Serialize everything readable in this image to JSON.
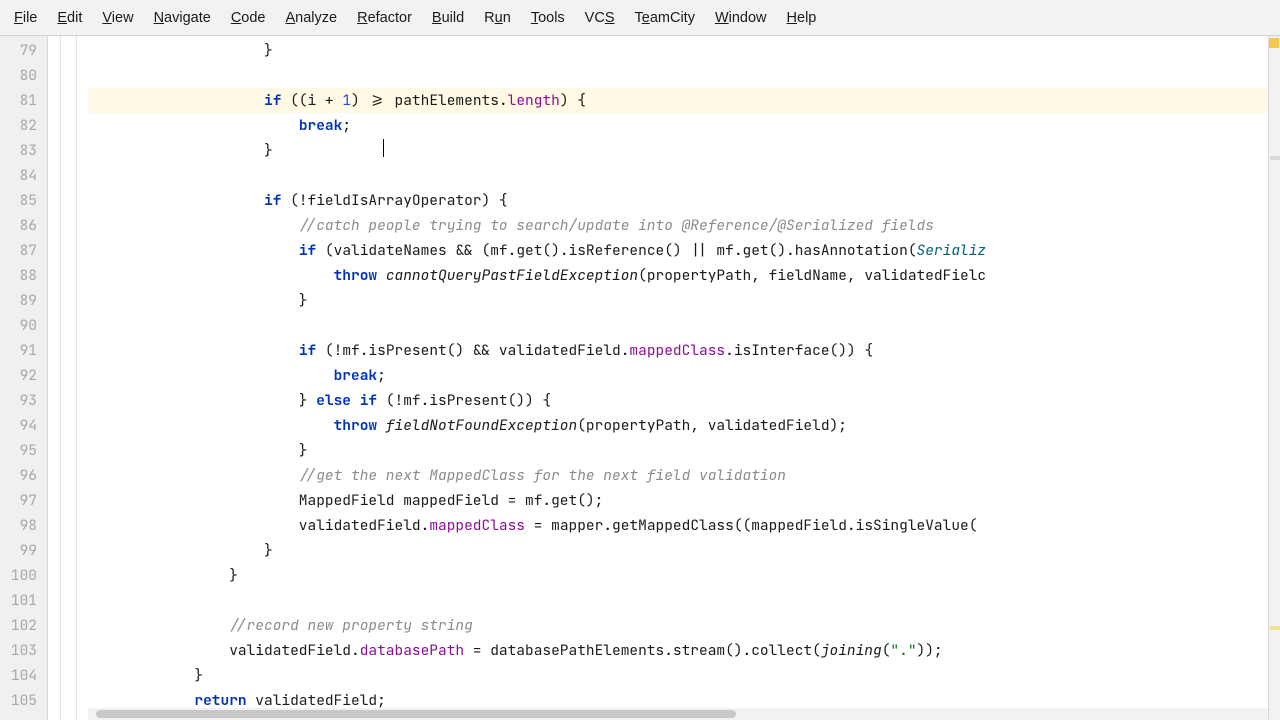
{
  "menu": {
    "items": [
      {
        "label": "File",
        "m": "F"
      },
      {
        "label": "Edit",
        "m": "E"
      },
      {
        "label": "View",
        "m": "V"
      },
      {
        "label": "Navigate",
        "m": "N"
      },
      {
        "label": "Code",
        "m": "C"
      },
      {
        "label": "Analyze",
        "m": "A"
      },
      {
        "label": "Refactor",
        "m": "R"
      },
      {
        "label": "Build",
        "m": "B"
      },
      {
        "label": "Run",
        "m": "u"
      },
      {
        "label": "Tools",
        "m": "T"
      },
      {
        "label": "VCS",
        "m": "S"
      },
      {
        "label": "TeamCity",
        "m": "e"
      },
      {
        "label": "Window",
        "m": "W"
      },
      {
        "label": "Help",
        "m": "H"
      }
    ]
  },
  "gutter": {
    "start": 79,
    "end": 105,
    "current": 81
  },
  "code": {
    "lines": [
      {
        "n": 79,
        "indent": 20,
        "tokens": [
          {
            "t": "}",
            "c": ""
          }
        ]
      },
      {
        "n": 80,
        "indent": 0,
        "tokens": []
      },
      {
        "n": 81,
        "indent": 20,
        "current": true,
        "tokens": [
          {
            "t": "if",
            "c": "kw"
          },
          {
            "t": " ((i + ",
            "c": ""
          },
          {
            "t": "1",
            "c": "num"
          },
          {
            "t": ") >= pathElements.",
            "c": ""
          },
          {
            "t": "length",
            "c": "field"
          },
          {
            "t": ") {",
            "c": ""
          }
        ]
      },
      {
        "n": 82,
        "indent": 24,
        "tokens": [
          {
            "t": "break",
            "c": "kw"
          },
          {
            "t": ";",
            "c": ""
          }
        ]
      },
      {
        "n": 83,
        "indent": 20,
        "tokens": [
          {
            "t": "}",
            "c": ""
          }
        ],
        "caret": true
      },
      {
        "n": 84,
        "indent": 0,
        "tokens": []
      },
      {
        "n": 85,
        "indent": 20,
        "tokens": [
          {
            "t": "if",
            "c": "kw"
          },
          {
            "t": " (!fieldIsArrayOperator) {",
            "c": ""
          }
        ]
      },
      {
        "n": 86,
        "indent": 24,
        "tokens": [
          {
            "t": "//catch people trying to search/update into @Reference/@Serialized fields",
            "c": "comment"
          }
        ]
      },
      {
        "n": 87,
        "indent": 24,
        "tokens": [
          {
            "t": "if",
            "c": "kw"
          },
          {
            "t": " (validateNames && (mf.get().isReference() || mf.get().hasAnnotation(",
            "c": ""
          },
          {
            "t": "Serializ",
            "c": "ref"
          }
        ]
      },
      {
        "n": 88,
        "indent": 28,
        "tokens": [
          {
            "t": "throw",
            "c": "kw"
          },
          {
            "t": " ",
            "c": ""
          },
          {
            "t": "cannotQueryPastFieldException",
            "c": "static"
          },
          {
            "t": "(propertyPath, fieldName, validatedFielc",
            "c": ""
          }
        ]
      },
      {
        "n": 89,
        "indent": 24,
        "tokens": [
          {
            "t": "}",
            "c": ""
          }
        ]
      },
      {
        "n": 90,
        "indent": 0,
        "tokens": []
      },
      {
        "n": 91,
        "indent": 24,
        "tokens": [
          {
            "t": "if",
            "c": "kw"
          },
          {
            "t": " (!mf.isPresent() && validatedField.",
            "c": ""
          },
          {
            "t": "mappedClass",
            "c": "field"
          },
          {
            "t": ".isInterface()) {",
            "c": ""
          }
        ]
      },
      {
        "n": 92,
        "indent": 28,
        "tokens": [
          {
            "t": "break",
            "c": "kw"
          },
          {
            "t": ";",
            "c": ""
          }
        ]
      },
      {
        "n": 93,
        "indent": 24,
        "tokens": [
          {
            "t": "} ",
            "c": ""
          },
          {
            "t": "else if",
            "c": "kw"
          },
          {
            "t": " (!mf.isPresent()) {",
            "c": ""
          }
        ]
      },
      {
        "n": 94,
        "indent": 28,
        "tokens": [
          {
            "t": "throw",
            "c": "kw"
          },
          {
            "t": " ",
            "c": ""
          },
          {
            "t": "fieldNotFoundException",
            "c": "static"
          },
          {
            "t": "(propertyPath, validatedField);",
            "c": ""
          }
        ]
      },
      {
        "n": 95,
        "indent": 24,
        "tokens": [
          {
            "t": "}",
            "c": ""
          }
        ]
      },
      {
        "n": 96,
        "indent": 24,
        "tokens": [
          {
            "t": "//get the next MappedClass for the next field validation",
            "c": "comment"
          }
        ]
      },
      {
        "n": 97,
        "indent": 24,
        "tokens": [
          {
            "t": "MappedField mappedField = mf.get();",
            "c": ""
          }
        ]
      },
      {
        "n": 98,
        "indent": 24,
        "tokens": [
          {
            "t": "validatedField.",
            "c": ""
          },
          {
            "t": "mappedClass",
            "c": "field"
          },
          {
            "t": " = mapper.getMappedClass((mappedField.isSingleValue(",
            "c": ""
          }
        ]
      },
      {
        "n": 99,
        "indent": 20,
        "tokens": [
          {
            "t": "}",
            "c": ""
          }
        ]
      },
      {
        "n": 100,
        "indent": 16,
        "tokens": [
          {
            "t": "}",
            "c": ""
          }
        ]
      },
      {
        "n": 101,
        "indent": 0,
        "tokens": []
      },
      {
        "n": 102,
        "indent": 16,
        "tokens": [
          {
            "t": "//record new property string",
            "c": "comment"
          }
        ]
      },
      {
        "n": 103,
        "indent": 16,
        "tokens": [
          {
            "t": "validatedField.",
            "c": ""
          },
          {
            "t": "databasePath",
            "c": "field"
          },
          {
            "t": " = databasePathElements.stream().collect(",
            "c": ""
          },
          {
            "t": "joining",
            "c": "static"
          },
          {
            "t": "(",
            "c": ""
          },
          {
            "t": "\".\"",
            "c": "str"
          },
          {
            "t": "));",
            "c": ""
          }
        ]
      },
      {
        "n": 104,
        "indent": 12,
        "tokens": [
          {
            "t": "}",
            "c": ""
          }
        ]
      },
      {
        "n": 105,
        "indent": 12,
        "tokens": [
          {
            "t": "return",
            "c": "kw"
          },
          {
            "t": " validatedField;",
            "c": ""
          }
        ]
      }
    ]
  }
}
